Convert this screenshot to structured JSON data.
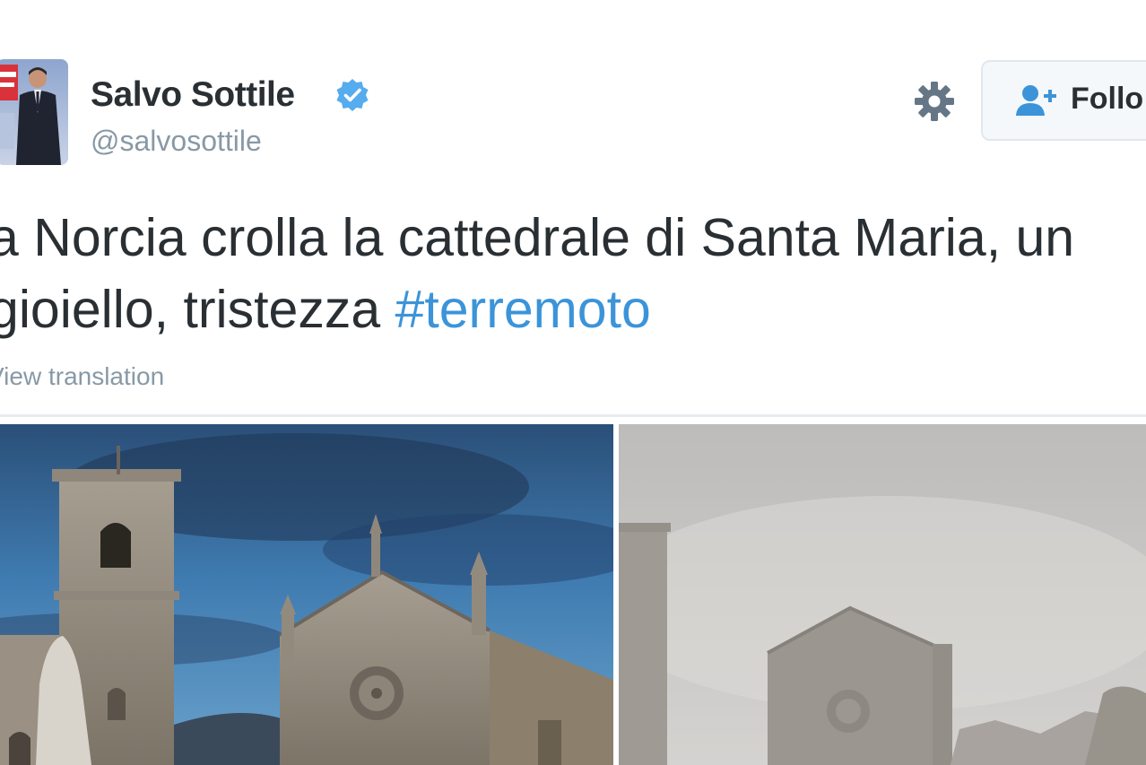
{
  "tweet": {
    "author": {
      "display_name": "Salvo Sottile",
      "handle": "@salvosottile",
      "verified": true,
      "avatar_icon": "avatar-photo"
    },
    "actions": {
      "settings_icon": "gear-icon",
      "follow_label": "Follo",
      "follow_icon": "follow-person-plus-icon"
    },
    "text": {
      "line1": "a Norcia crolla la cattedrale di Santa Maria, un",
      "line2_prefix": "gioiello, tristezza ",
      "hashtag": "#terremoto"
    },
    "view_translation": "View translation",
    "media": [
      {
        "name": "photo-cathedral-before",
        "description_icon": "photo"
      },
      {
        "name": "photo-cathedral-after",
        "description_icon": "photo"
      }
    ]
  },
  "colors": {
    "text": "#292f33",
    "muted": "#8899a6",
    "link": "#3b94d9",
    "verified_badge": "#55acee",
    "button_bg": "#f5f8fa",
    "button_border": "#e1e8ed",
    "divider": "#e6ecf0"
  }
}
